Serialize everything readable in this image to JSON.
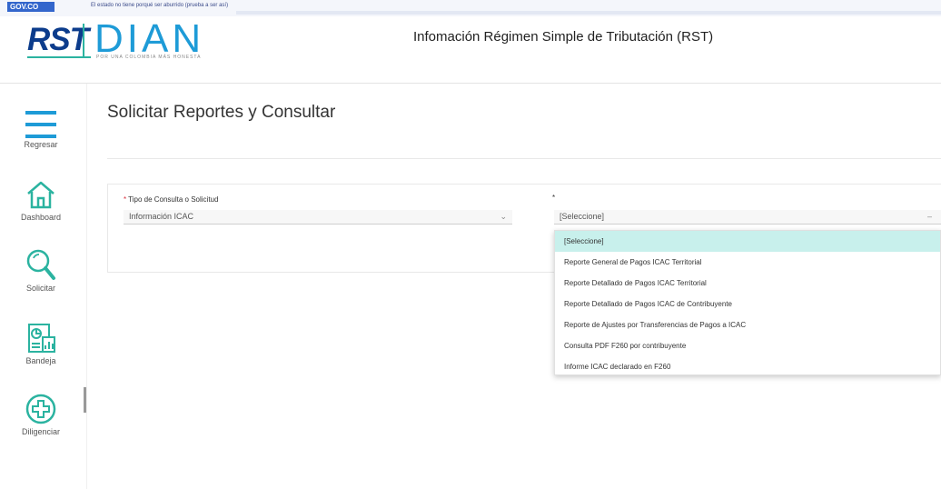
{
  "govbar": {
    "logo_text": "GOV.CO",
    "note": "El estado no tiene porqué ser aburrido (prueba a ser así)"
  },
  "header": {
    "logo_rst": "RST",
    "logo_dian": "DIAN",
    "logo_tagline": "POR UNA COLOMBIA MÁS HONESTA",
    "title": "Infomación Régimen Simple de Tributación (RST)"
  },
  "sidebar": {
    "items": [
      {
        "label": "Regresar",
        "icon": "menu-icon"
      },
      {
        "label": "Dashboard",
        "icon": "home-icon"
      },
      {
        "label": "Solicitar",
        "icon": "search-icon"
      },
      {
        "label": "Bandeja",
        "icon": "report-icon"
      },
      {
        "label": "Diligenciar",
        "icon": "add-circle-icon"
      }
    ]
  },
  "main": {
    "page_title": "Solicitar Reportes y Consultar",
    "field1": {
      "required_mark": "*",
      "label": "Tipo de Consulta o Solicitud",
      "value": "Información ICAC"
    },
    "field2": {
      "required_mark": "*",
      "value": "[Seleccione]"
    },
    "dropdown_options": [
      "[Seleccione]",
      "Reporte General de Pagos ICAC Territorial",
      "Reporte Detallado de Pagos ICAC Territorial",
      "Reporte Detallado de Pagos ICAC de Contribuyente",
      "Reporte de Ajustes por Transferencias de Pagos a ICAC",
      "Consulta PDF F260 por contribuyente",
      "Informe ICAC declarado en F260"
    ]
  },
  "colors": {
    "accent": "#1e9bd7",
    "brand_dark": "#0c3c8c",
    "teal": "#2bb3a0",
    "selected_option": "#c8f0ec",
    "required": "#d9303c"
  }
}
